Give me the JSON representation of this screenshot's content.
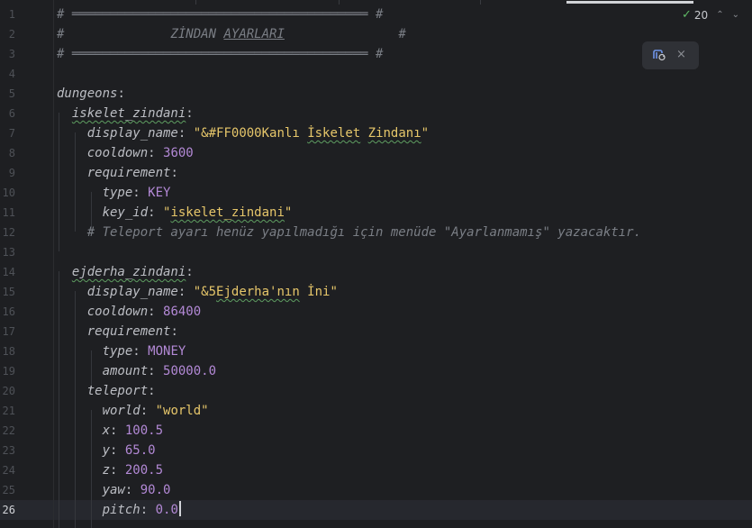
{
  "inspection": {
    "count": "20",
    "check_icon": "✓"
  },
  "popup": {
    "icon": "refresh-icon",
    "close": "×"
  },
  "gutter": {
    "lines": [
      "1",
      "2",
      "3",
      "4",
      "5",
      "6",
      "7",
      "8",
      "9",
      "10",
      "11",
      "12",
      "13",
      "14",
      "15",
      "16",
      "17",
      "18",
      "19",
      "20",
      "21",
      "22",
      "23",
      "24",
      "25",
      "26"
    ],
    "current_line": "26"
  },
  "code": {
    "l1": {
      "hash1": "#",
      "bar": "═══════════════════════════════════════",
      "hash2": "#"
    },
    "l2": {
      "hash1": "#",
      "title_a": "ZİNDAN ",
      "title_b": "AYARLARI",
      "hash2": "#"
    },
    "l3": {
      "hash1": "#",
      "bar": "═══════════════════════════════════════",
      "hash2": "#"
    },
    "l5": {
      "key": "dungeons",
      "colon": ":"
    },
    "l6": {
      "key": "iskelet_zindani",
      "colon": ":"
    },
    "l7": {
      "key": "display_name",
      "colon": ": ",
      "q1": "\"",
      "code": "&#FF0000",
      "w1": "Kanlı ",
      "w2": "İskelet",
      "w3": " ",
      "w4": "Zindanı",
      "q2": "\""
    },
    "l8": {
      "key": "cooldown",
      "colon": ": ",
      "value": "3600"
    },
    "l9": {
      "key": "requirement",
      "colon": ":"
    },
    "l10": {
      "key": "type",
      "colon": ": ",
      "value": "KEY"
    },
    "l11": {
      "key": "key_id",
      "colon": ": ",
      "q1": "\"",
      "value": "iskelet_zindani",
      "q2": "\""
    },
    "l12": {
      "comment": "# Teleport ayarı henüz yapılmadığı için menüde \"Ayarlanmamış\" yazacaktır."
    },
    "l14": {
      "key": "ejderha_zindani",
      "colon": ":"
    },
    "l15": {
      "key": "display_name",
      "colon": ": ",
      "q1": "\"",
      "code": "&5",
      "w1": "Ejderha'nın",
      "w2": " İni",
      "q2": "\""
    },
    "l16": {
      "key": "cooldown",
      "colon": ": ",
      "value": "86400"
    },
    "l17": {
      "key": "requirement",
      "colon": ":"
    },
    "l18": {
      "key": "type",
      "colon": ": ",
      "value": "MONEY"
    },
    "l19": {
      "key": "amount",
      "colon": ": ",
      "value": "50000.0"
    },
    "l20": {
      "key": "teleport",
      "colon": ":"
    },
    "l21": {
      "key": "world",
      "colon": ": ",
      "value": "\"world\""
    },
    "l22": {
      "key": "x",
      "colon": ": ",
      "value": "100.5"
    },
    "l23": {
      "key": "y",
      "colon": ": ",
      "value": "65.0"
    },
    "l24": {
      "key": "z",
      "colon": ": ",
      "value": "200.5"
    },
    "l25": {
      "key": "yaw",
      "colon": ": ",
      "value": "90.0"
    },
    "l26": {
      "key": "pitch",
      "colon": ": ",
      "value": "0.0"
    }
  }
}
